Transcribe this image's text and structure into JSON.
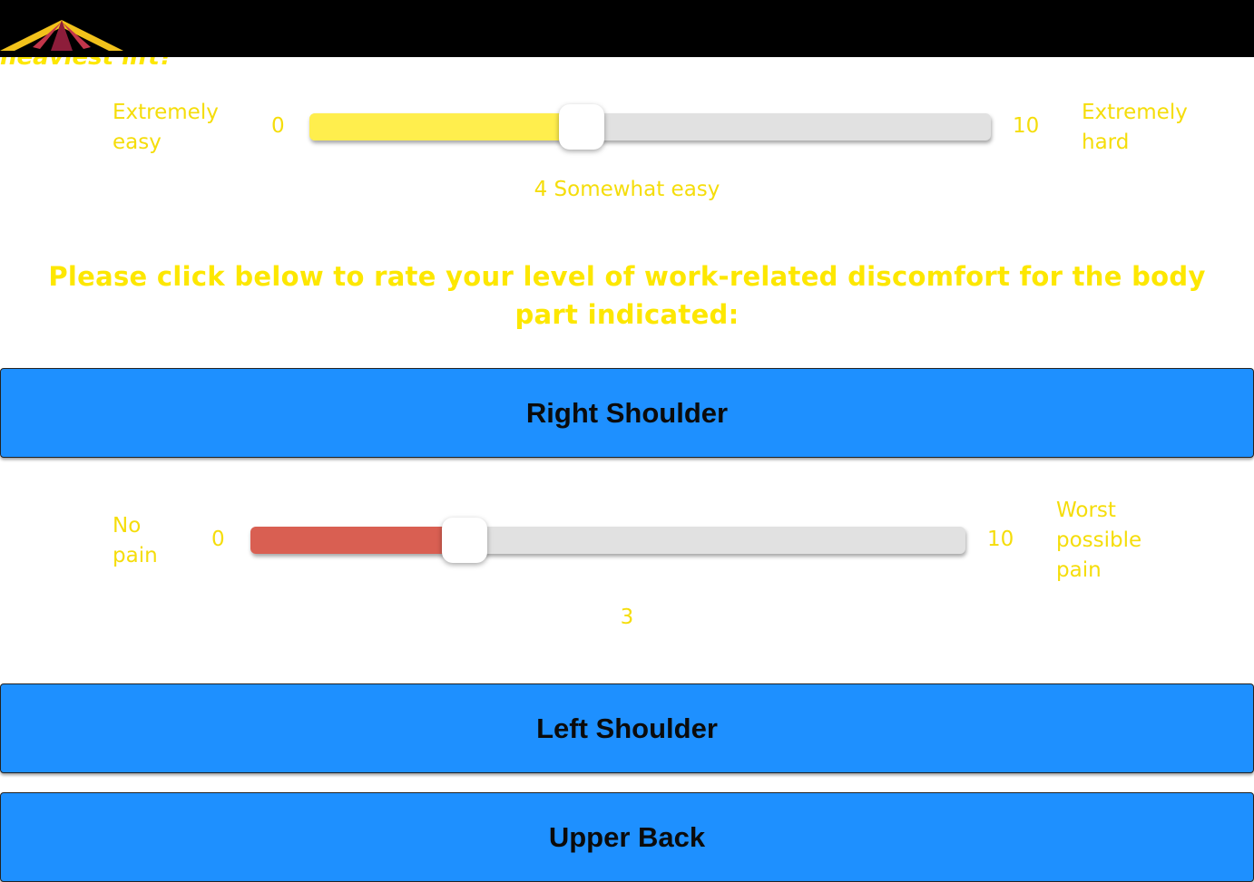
{
  "header": {
    "logo_icon": "tent-roof-logo-icon"
  },
  "question_cut": "heaviest lift?",
  "effort_slider": {
    "left_label": "Extremely easy",
    "left_label_lines": [
      "Extremely",
      "easy"
    ],
    "min": "0",
    "max": "10",
    "right_label_lines": [
      "Extremely",
      "hard"
    ],
    "value": 4,
    "value_text": "4 Somewhat easy",
    "fill_color": "#ffee4d"
  },
  "instruction": "Please click below to rate your level of work-related discomfort for the body part indicated:",
  "body_parts": {
    "right_shoulder": "Right Shoulder",
    "left_shoulder": "Left Shoulder",
    "upper_back": "Upper Back"
  },
  "pain_slider": {
    "left_label_lines": [
      "No",
      "pain"
    ],
    "min": "0",
    "max": "10",
    "right_label_lines": [
      "Worst",
      "possible",
      "pain"
    ],
    "value": 3,
    "value_text": "3",
    "fill_color": "#d95f52"
  },
  "colors": {
    "header_bg": "#000000",
    "text_yellow": "#f5dd0a",
    "button_blue": "#1e90ff"
  }
}
